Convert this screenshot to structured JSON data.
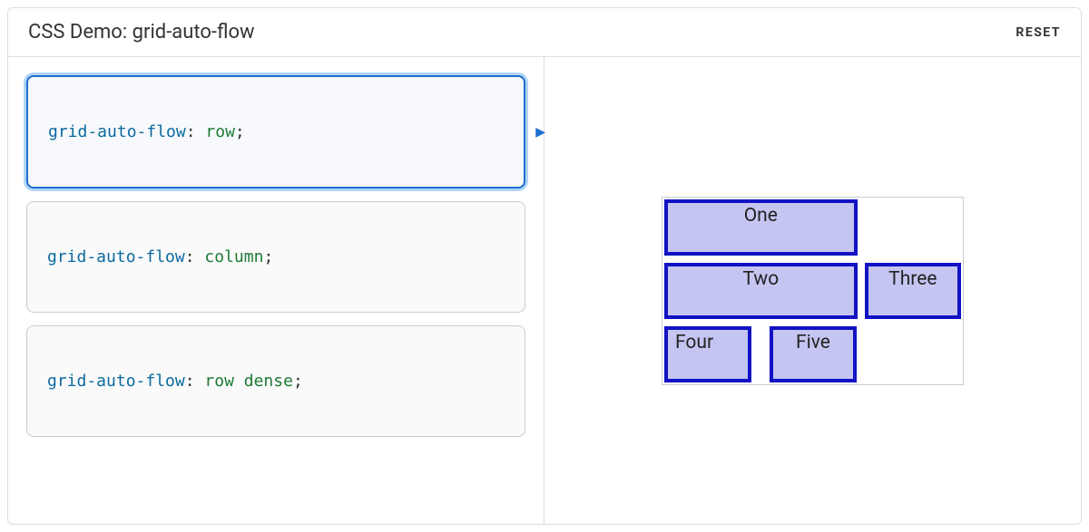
{
  "header": {
    "title": "CSS Demo: grid-auto-flow",
    "reset_label": "RESET"
  },
  "options": [
    {
      "property": "grid-auto-flow",
      "value": "row",
      "selected": true
    },
    {
      "property": "grid-auto-flow",
      "value": "column",
      "selected": false
    },
    {
      "property": "grid-auto-flow",
      "value": "row dense",
      "selected": false
    }
  ],
  "grid_items": {
    "one": "One",
    "two": "Two",
    "three": "Three",
    "four": "Four",
    "five": "Five"
  },
  "punct": {
    "colon_space": ": ",
    "semicolon": ";"
  },
  "icons": {
    "arrow": "▶"
  }
}
